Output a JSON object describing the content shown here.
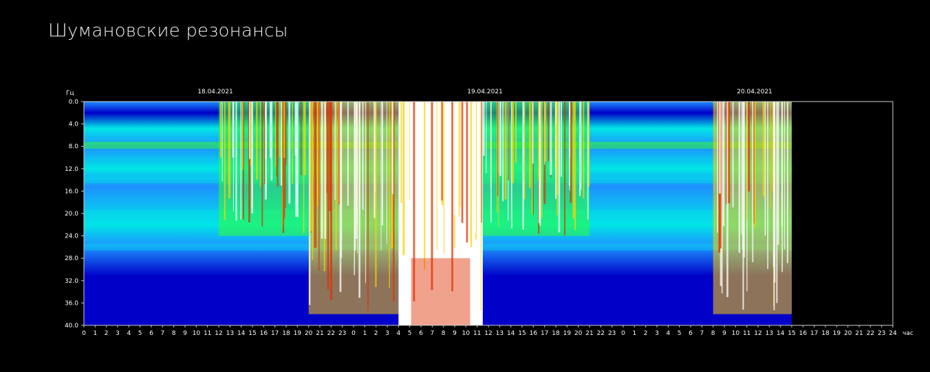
{
  "page": {
    "title": "Шумановские резонансы"
  },
  "colors": {
    "background": "#000000",
    "low": "#0000c8",
    "mid_low": "#1e90ff",
    "mid": "#00e6e6",
    "mid_high": "#32ff32",
    "high": "#ffd200",
    "peak": "#e03000",
    "saturated": "#ffffff"
  },
  "chart_data": {
    "type": "heatmap",
    "ylabel": "Гц",
    "xlabel": "час",
    "y_ticks": [
      "0.0",
      "4.0",
      "8.0",
      "12.0",
      "16.0",
      "20.0",
      "24.0",
      "28.0",
      "32.0",
      "36.0",
      "40.0"
    ],
    "ylim": [
      0,
      40
    ],
    "x_hours_per_day": 24,
    "days": 3,
    "x_ticks": [
      "0",
      "1",
      "2",
      "3",
      "4",
      "5",
      "6",
      "7",
      "8",
      "9",
      "10",
      "11",
      "12",
      "13",
      "14",
      "15",
      "16",
      "17",
      "18",
      "19",
      "20",
      "21",
      "22",
      "23",
      "0",
      "1",
      "2",
      "3",
      "4",
      "5",
      "6",
      "7",
      "8",
      "9",
      "10",
      "11",
      "12",
      "13",
      "14",
      "15",
      "16",
      "17",
      "18",
      "19",
      "20",
      "21",
      "22",
      "23",
      "0",
      "1",
      "2",
      "3",
      "4",
      "5",
      "6",
      "7",
      "8",
      "9",
      "10",
      "11",
      "12",
      "13",
      "14",
      "15",
      "16",
      "17",
      "18",
      "19",
      "20",
      "21",
      "22",
      "23",
      "24"
    ],
    "dates": [
      {
        "label": "18.04.2021",
        "hour_index": 12
      },
      {
        "label": "19.04.2021",
        "hour_index": 36
      },
      {
        "label": "20.04.2021",
        "hour_index": 60
      }
    ],
    "data_end_hour_index": 63,
    "resonance_bands_hz": [
      7.8,
      14.0,
      20.0,
      26.0
    ],
    "activity_periods": [
      {
        "start_hour_index": 12,
        "end_hour_index": 20,
        "level": "medium"
      },
      {
        "start_hour_index": 20,
        "end_hour_index": 28,
        "level": "high"
      },
      {
        "start_hour_index": 28,
        "end_hour_index": 35.5,
        "level": "saturated"
      },
      {
        "start_hour_index": 35.5,
        "end_hour_index": 45,
        "level": "medium"
      },
      {
        "start_hour_index": 56,
        "end_hour_index": 63,
        "level": "high"
      }
    ]
  }
}
